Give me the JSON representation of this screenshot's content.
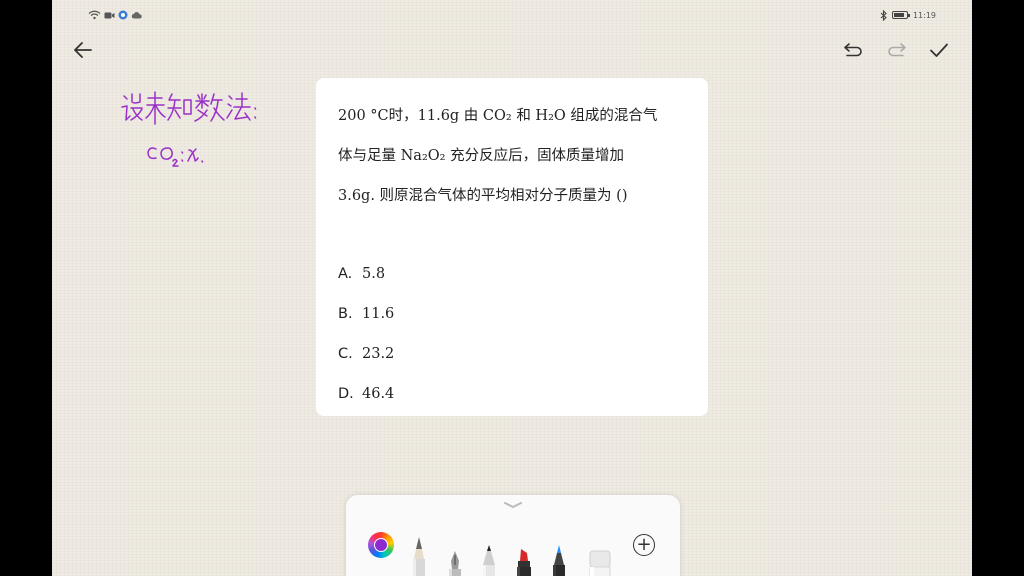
{
  "status": {
    "time": "11:19"
  },
  "toolbar": {
    "back_icon": "arrow-left-icon",
    "undo_icon": "undo-icon",
    "redo_icon": "redo-icon",
    "done_icon": "checkmark-icon"
  },
  "question": {
    "lines": [
      "200 °C时，11.6g 由 CO₂ 和 H₂O 组成的混合气",
      "体与足量 Na₂O₂ 充分反应后，固体质量增加",
      "3.6g. 则原混合气体的平均相对分子质量为 ()"
    ],
    "options": [
      {
        "letter": "A.",
        "value": "5.8"
      },
      {
        "letter": "B.",
        "value": "11.6"
      },
      {
        "letter": "C.",
        "value": "23.2"
      },
      {
        "letter": "D.",
        "value": "46.4"
      }
    ]
  },
  "handwriting": {
    "color": "#9b30c8",
    "line1": "设未知数法:",
    "line2": "CO₂: x."
  },
  "pen_tray": {
    "selected_color": "#8e2bd0",
    "tools": [
      "pencil",
      "fountain-pen",
      "ballpoint-pen",
      "marker",
      "brush-pen",
      "eraser"
    ],
    "add_label": "+"
  }
}
